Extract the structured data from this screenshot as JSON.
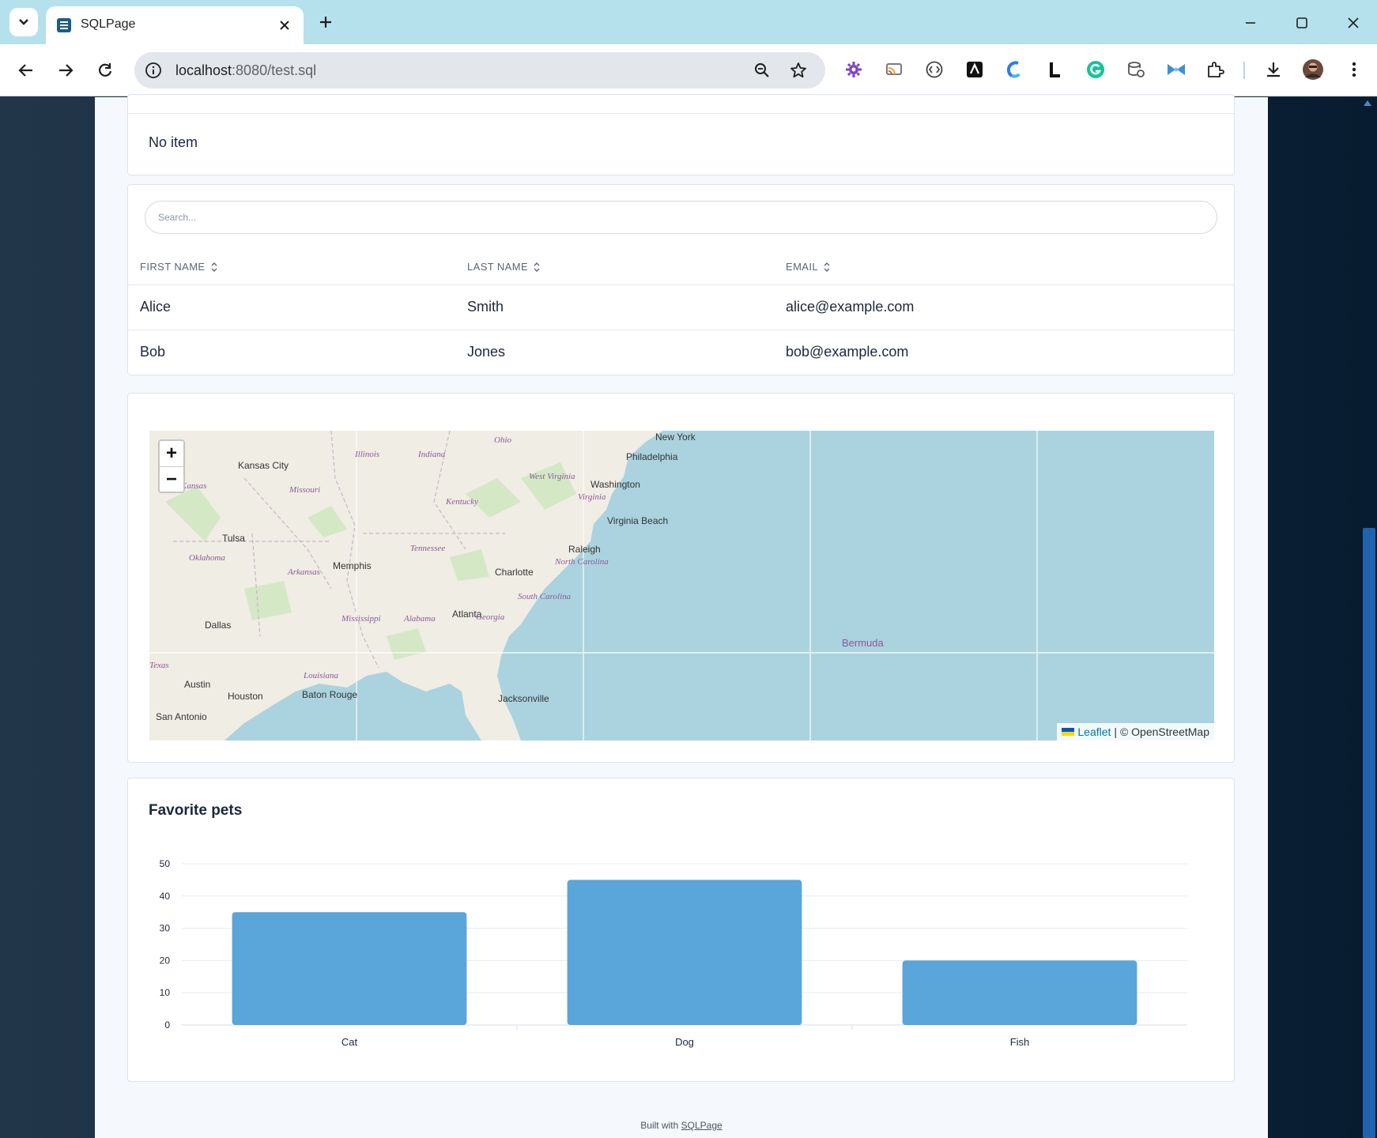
{
  "browser": {
    "tab_title": "SQLPage",
    "url_host": "localhost",
    "url_rest": ":8080/test.sql"
  },
  "list": {
    "empty_text": "No item"
  },
  "table": {
    "search_placeholder": "Search...",
    "columns": [
      "FIRST NAME",
      "LAST NAME",
      "EMAIL"
    ],
    "rows": [
      [
        "Alice",
        "Smith",
        "alice@example.com"
      ],
      [
        "Bob",
        "Jones",
        "bob@example.com"
      ]
    ]
  },
  "map": {
    "labels": {
      "cities": [
        "New York",
        "Philadelphia",
        "Kansas City",
        "Washington",
        "Virginia Beach",
        "Tulsa",
        "Memphis",
        "Raleigh",
        "Charlotte",
        "Atlanta",
        "Dallas",
        "Austin",
        "Houston",
        "Baton Rouge",
        "Jacksonville",
        "San Antonio"
      ],
      "states": [
        "Ohio",
        "Illinois",
        "Indiana",
        "West Virginia",
        "Missouri",
        "Kentucky",
        "Virginia",
        "Tennessee",
        "Oklahoma",
        "Arkansas",
        "North Carolina",
        "South Carolina",
        "Mississippi",
        "Alabama",
        "Georgia",
        "Louisiana",
        "Texas",
        "Kansas"
      ],
      "islands": [
        "Bermuda"
      ]
    },
    "zoom_in": "+",
    "zoom_out": "−",
    "attribution_link": "Leaflet",
    "attribution_text": "| © OpenStreetMap"
  },
  "chart_data": {
    "type": "bar",
    "title": "Favorite pets",
    "categories": [
      "Cat",
      "Dog",
      "Fish"
    ],
    "values": [
      35,
      45,
      20
    ],
    "ylim": [
      0,
      50
    ],
    "yticks": [
      0,
      10,
      20,
      30,
      40,
      50
    ],
    "color": "#5aa5da",
    "grid": true,
    "xlabel": "",
    "ylabel": ""
  },
  "footer": {
    "prefix": "Built with",
    "link": "SQLPage"
  },
  "colors": {
    "tabbar": "#b5e1ec",
    "water": "#aad3df",
    "land": "#f0ede4",
    "bar": "#5aa5da",
    "scroll_thumb": "#1f63ad"
  },
  "icons": [
    "chevron-down-icon",
    "database-icon",
    "close-icon",
    "plus-icon",
    "minimize-icon",
    "maximize-icon",
    "back-arrow-icon",
    "forward-arrow-icon",
    "reload-icon",
    "info-icon",
    "zoom-icon",
    "star-icon",
    "extension-icon",
    "download-icon",
    "profile-avatar-icon",
    "more-vert-icon",
    "sort-icon"
  ]
}
